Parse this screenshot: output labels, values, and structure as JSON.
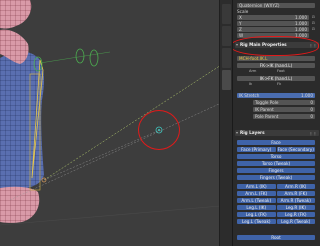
{
  "rotation_panel": {
    "mode": "Quaternion (WXYZ)",
    "label": "Scale",
    "rows": [
      {
        "axis": "X",
        "value": "1.000"
      },
      {
        "axis": "Y",
        "value": "1.000"
      },
      {
        "axis": "Z",
        "value": "1.000"
      },
      {
        "axis": "W",
        "value": "1.000"
      }
    ]
  },
  "rig_main": {
    "title": "Rig Main Properties",
    "bone": "MCH-foot.IK.L",
    "fk_ik_label": "FK->IK (hand.L)",
    "ik_fk_label": "IK->FK (hand.L)",
    "small_a": "Arm",
    "small_b": "Foot",
    "small_c": "Ik",
    "small_d": "Fk",
    "ik_stretch": {
      "label": "IK Stretch",
      "value": "1.000"
    },
    "toggle_pole": {
      "label": "Toggle Pole",
      "value": "0"
    },
    "ik_parent": {
      "label": "IK Parent",
      "value": "0"
    },
    "pole_parent": {
      "label": "Pole Parent",
      "value": "0"
    }
  },
  "rig_layers": {
    "title": "Rig Layers",
    "rows": [
      [
        "Face"
      ],
      [
        "Face (Primary)",
        "Face (Secondary)"
      ],
      [
        "Torso"
      ],
      [
        "Torso (Tweak)"
      ],
      [
        "Fingers"
      ],
      [
        "Fingers (Tweak)"
      ],
      [
        "Arm.L (IK)",
        "Arm.R (IK)"
      ],
      [
        "Arm.L (FK)",
        "Arm.R (FK)"
      ],
      [
        "Arm.L (Tweak)",
        "Arm.R (Tweak)"
      ],
      [
        "Leg.L (IK)",
        "Leg.R (IK)"
      ],
      [
        "Leg.L (FK)",
        "Leg.R (FK)"
      ],
      [
        "Leg.L (Tweak)",
        "Leg.R (Tweak)"
      ],
      [
        "Root"
      ]
    ]
  },
  "colors": {
    "accent": "#3f63a8",
    "annotation": "#e01a1a",
    "selected_bone": "#e8c84a",
    "mesh": "#5a6fb0",
    "skin": "#d99aa8"
  }
}
